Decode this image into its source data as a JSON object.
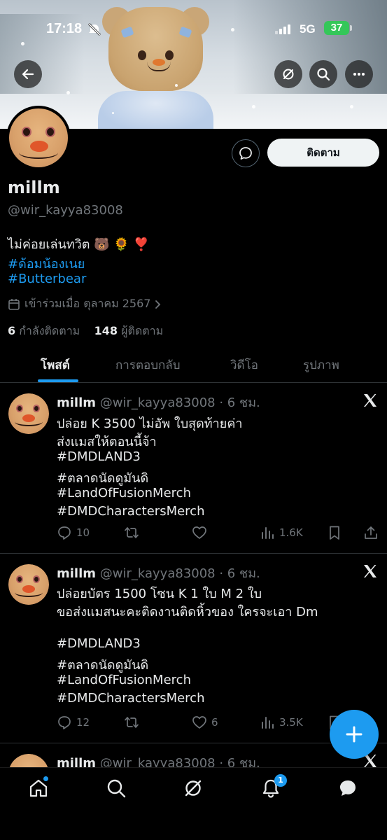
{
  "status_bar": {
    "time": "17:18",
    "network": "5G",
    "battery": "37"
  },
  "header": {
    "back_icon": "arrow-left-icon",
    "grok_icon": "grok-icon",
    "search_icon": "search-icon",
    "more_icon": "more-icon"
  },
  "profile": {
    "display_name": "millm",
    "handle": "@wir_kayya83008",
    "bio_line1": "ไม่ค่อยเล่นทวิต 🐻 🌻 ❣️",
    "hashtag1": "#ด้อมน้องเนย",
    "hashtag2": "#Butterbear",
    "joined": "เข้าร่วมเมื่อ ตุลาคม 2567",
    "following_count": "6",
    "following_label": "กำลังติดตาม",
    "followers_count": "148",
    "followers_label": "ผู้ติดตาม",
    "follow_button": "ติดตาม"
  },
  "tabs": [
    {
      "label": "โพสต์",
      "active": true
    },
    {
      "label": "การตอบกลับ",
      "active": false
    },
    {
      "label": "วิดีโอ",
      "active": false
    },
    {
      "label": "รูปภาพ",
      "active": false
    }
  ],
  "tweets": [
    {
      "name": "millm",
      "handle": "@wir_kayya83008",
      "time": "· 6 ชม.",
      "lines": [
        "ปล่อย K 3500 ไม่อัพ ใบสุดท้ายค่า",
        "ส่งแมสให้ตอนนี้จ้า"
      ],
      "hashtags": [
        "#DMDLAND3",
        "#ตลาดนัดดูมันดิ",
        "#LandOfFusionMerch",
        "#DMDCharactersMerch"
      ],
      "replies": "10",
      "retweets": "",
      "likes": "",
      "views": "1.6K"
    },
    {
      "name": "millm",
      "handle": "@wir_kayya83008",
      "time": "· 6 ชม.",
      "lines": [
        "ปล่อยบัตร 1500 โซน K 1 ใบ M 2 ใบ",
        "ขอส่งแมสนะคะติดงานติดหิ้วของ ใครจะเอา Dm"
      ],
      "hashtags": [
        "#DMDLAND3",
        "#ตลาดนัดดูมันดิ",
        "#LandOfFusionMerch",
        "#DMDCharactersMerch"
      ],
      "replies": "12",
      "retweets": "",
      "likes": "6",
      "views": "3.5K"
    },
    {
      "name": "millm",
      "handle": "@wir_kayya83008",
      "time": "· 6 ชม."
    }
  ],
  "bottom_nav": {
    "items": [
      "home-icon",
      "search-icon",
      "grok-icon",
      "notifications-icon",
      "messages-icon"
    ],
    "notification_badge": "1"
  },
  "colors": {
    "accent": "#1d9bf0",
    "background": "#000000",
    "text": "#e7e9ea",
    "muted": "#71767b"
  }
}
